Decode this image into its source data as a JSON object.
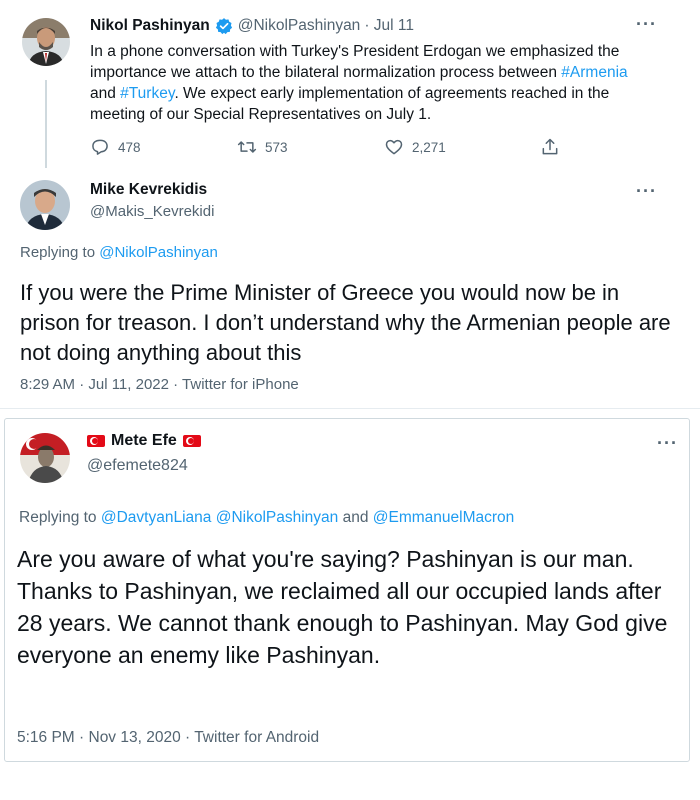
{
  "tweet1": {
    "author_name": "Nikol Pashinyan",
    "handle": "@NikolPashinyan",
    "date": "· Jul 11",
    "body_part1": "In a phone conversation with Turkey's President Erdogan we emphasized the importance we attach to the bilateral normalization process between ",
    "hashtag1": "#Armenia",
    "body_and": " and ",
    "hashtag2": "#Turkey",
    "body_part2": ". We expect early implementation of agreements reached in the meeting of our Special Representatives on July 1.",
    "replies": "478",
    "retweets": "573",
    "likes": "2,271",
    "more": "···"
  },
  "tweet2": {
    "author_name": "Mike Kevrekidis",
    "handle": "@Makis_Kevrekidi",
    "replying_prefix": "Replying to ",
    "replying_to": "@NikolPashinyan",
    "text": "If you were the Prime Minister of Greece you would now be in prison for treason. I don’t understand why the Armenian people are not doing anything about this",
    "meta": "8:29 AM · Jul 11, 2022 · Twitter for iPhone",
    "more": "···"
  },
  "tweet3": {
    "author_name": "Mete Efe",
    "handle": "@efemete824",
    "replying_prefix": "Replying to ",
    "mention1": "@DavtyanLiana",
    "mention2": "@NikolPashinyan",
    "replying_and": " and ",
    "mention3": "@EmmanuelMacron",
    "text": "Are you aware of what you're saying? Pashinyan is our man. Thanks to Pashinyan, we reclaimed all our occupied lands after 28 years. We cannot thank enough to Pashinyan. May God give everyone an enemy like Pashinyan.",
    "meta": "5:16 PM · Nov 13, 2020 · Twitter for Android",
    "more": "···"
  },
  "colors": {
    "link": "#1d9bf0",
    "text": "#0f1419",
    "muted": "#536471",
    "border": "#cfd9de",
    "flag": "#e30a17"
  },
  "icons": [
    "verified-icon",
    "reply-icon",
    "retweet-icon",
    "like-icon",
    "share-icon",
    "more-icon",
    "turkish-flag-icon"
  ]
}
